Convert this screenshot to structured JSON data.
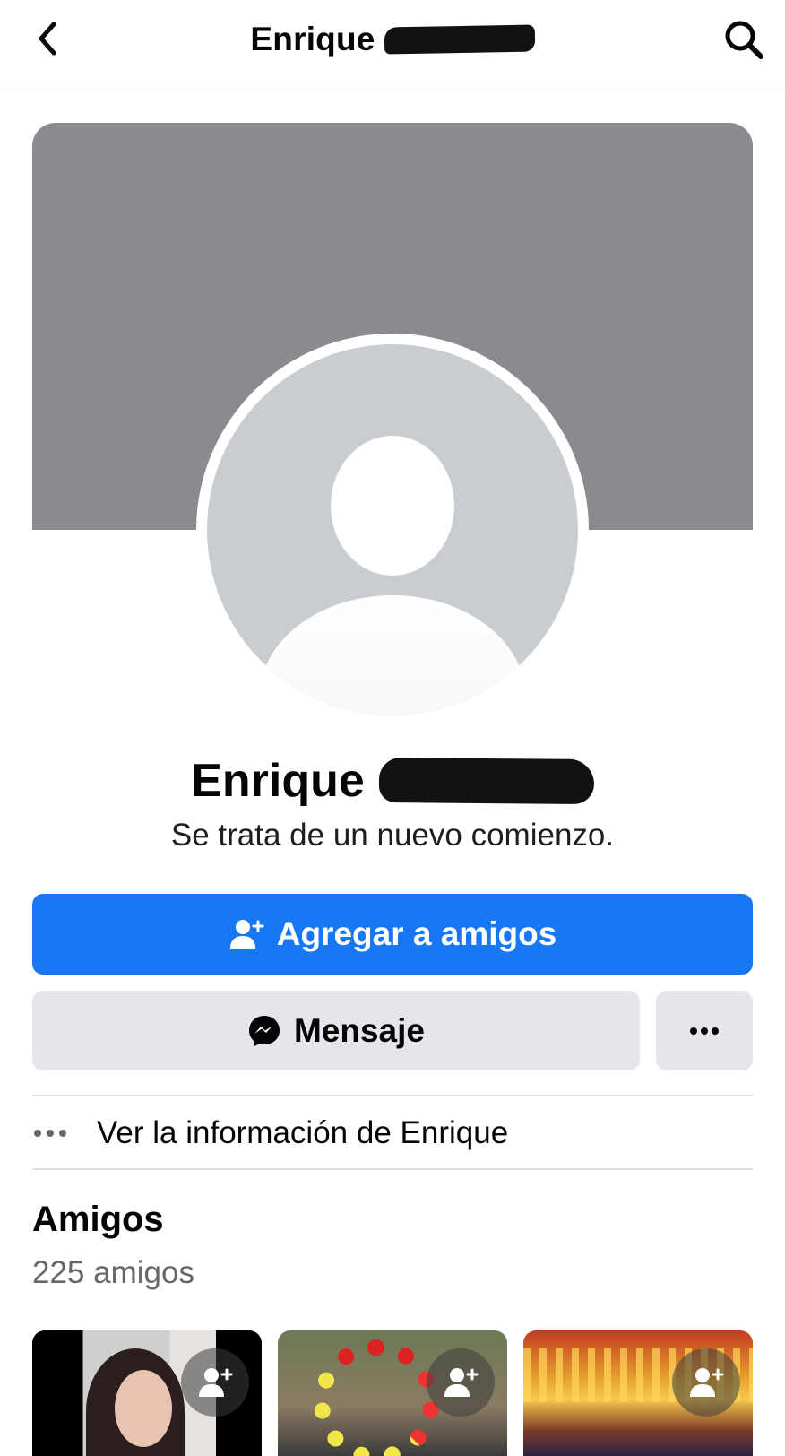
{
  "header": {
    "title": "Enrique",
    "back_icon": "chevron-left-icon",
    "search_icon": "search-icon"
  },
  "profile": {
    "first_name": "Enrique",
    "bio": "Se trata de un nuevo comienzo."
  },
  "actions": {
    "add_friend_label": "Agregar a amigos",
    "message_label": "Mensaje",
    "accent_color": "#1877f2",
    "secondary_color": "#e4e6eb"
  },
  "info": {
    "label": "Ver la información de Enrique"
  },
  "friends": {
    "title": "Amigos",
    "count_label": "225 amigos",
    "cards": [
      {
        "icon": "add-friend-icon"
      },
      {
        "icon": "add-friend-icon"
      },
      {
        "icon": "add-friend-icon"
      }
    ]
  }
}
